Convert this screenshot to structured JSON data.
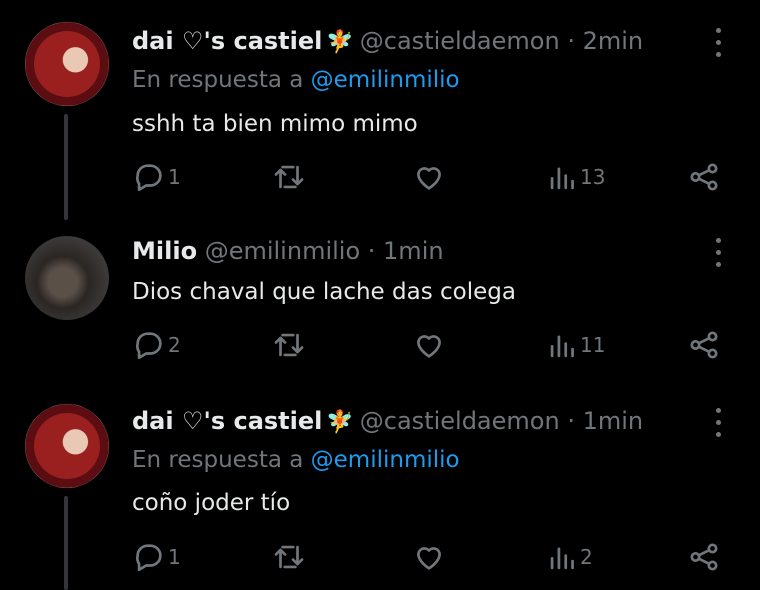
{
  "tweets": [
    {
      "name": "dai ♡'s castiel",
      "emoji": "🧚",
      "handle": "@castieldaemon",
      "time": "· 2min",
      "reply_prefix": "En respuesta a",
      "reply_to": "@emilinmilio",
      "text": "sshh ta bien mimo mimo",
      "replies": "1",
      "retweets": "",
      "likes": "",
      "views": "13"
    },
    {
      "name": "Milio",
      "handle": "@emilinmilio",
      "time": "· 1min",
      "text": "Dios chaval que lache das colega",
      "replies": "2",
      "retweets": "",
      "likes": "",
      "views": "11"
    },
    {
      "name": "dai ♡'s castiel",
      "emoji": "🧚",
      "handle": "@castieldaemon",
      "time": "· 1min",
      "reply_prefix": "En respuesta a",
      "reply_to": "@emilinmilio",
      "text": "coño joder tío",
      "replies": "1",
      "retweets": "",
      "likes": "",
      "views": "2"
    }
  ],
  "colors": {
    "background": "#000000",
    "text": "#e7e9ea",
    "muted": "#71767b",
    "link": "#1d9bf0"
  },
  "icons": [
    "reply-icon",
    "retweet-icon",
    "like-icon",
    "views-icon",
    "share-icon",
    "more-icon"
  ]
}
